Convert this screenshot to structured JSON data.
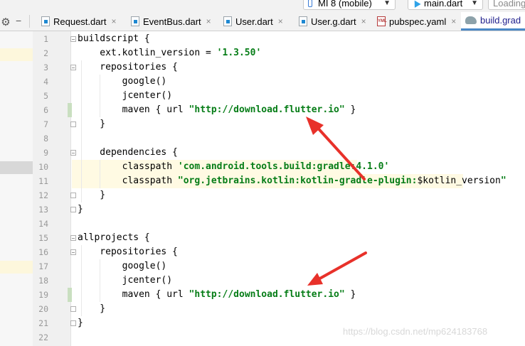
{
  "toolbar": {
    "device": "MI 8 (mobile)",
    "config": "main.dart",
    "loading": "Loading"
  },
  "tabs": [
    {
      "label": "Request.dart",
      "icon": "dart-file-icon",
      "active": false
    },
    {
      "label": "EventBus.dart",
      "icon": "dart-file-icon",
      "active": false
    },
    {
      "label": "User.dart",
      "icon": "dart-file-icon",
      "active": false
    },
    {
      "label": "User.g.dart",
      "icon": "dart-file-icon",
      "active": false
    },
    {
      "label": "pubspec.yaml",
      "icon": "yaml-file-icon",
      "active": false
    },
    {
      "label": "build.grad",
      "icon": "gradle-file-icon",
      "active": true
    }
  ],
  "editor": {
    "line_numbers": [
      "1",
      "2",
      "3",
      "4",
      "5",
      "6",
      "7",
      "8",
      "9",
      "10",
      "11",
      "12",
      "13",
      "14",
      "15",
      "16",
      "17",
      "18",
      "19",
      "20",
      "21",
      "22"
    ],
    "lines": [
      [
        {
          "t": "buildscript {"
        }
      ],
      [
        {
          "t": "    ext.kotlin_version = "
        },
        {
          "t": "'1.3.50'",
          "s": 1
        }
      ],
      [
        {
          "t": "    repositories {"
        }
      ],
      [
        {
          "t": "        google()"
        }
      ],
      [
        {
          "t": "        jcenter()"
        }
      ],
      [
        {
          "t": "        maven { url "
        },
        {
          "t": "\"http://download.flutter.io\"",
          "s": 1
        },
        {
          "t": " }"
        }
      ],
      [
        {
          "t": "    }"
        }
      ],
      [
        {
          "t": ""
        }
      ],
      [
        {
          "t": "    dependencies {"
        }
      ],
      [
        {
          "t": "        classpath "
        },
        {
          "t": "'com.android.tools.build:gradle:4.1.0'",
          "s": 1
        }
      ],
      [
        {
          "t": "        classpath "
        },
        {
          "t": "\"org.jetbrains.kotlin:kotlin-gradle-plugin:",
          "s": 1
        },
        {
          "t": "$kotlin_version"
        },
        {
          "t": "\"",
          "s": 1
        }
      ],
      [
        {
          "t": "    }"
        }
      ],
      [
        {
          "t": "}"
        }
      ],
      [
        {
          "t": ""
        }
      ],
      [
        {
          "t": "allprojects {"
        }
      ],
      [
        {
          "t": "    repositories {"
        }
      ],
      [
        {
          "t": "        google()"
        }
      ],
      [
        {
          "t": "        jcenter()"
        }
      ],
      [
        {
          "t": "        maven { url "
        },
        {
          "t": "\"http://download.flutter.io\"",
          "s": 1
        },
        {
          "t": " }"
        }
      ],
      [
        {
          "t": "    }"
        }
      ],
      [
        {
          "t": "}"
        }
      ],
      [
        {
          "t": ""
        }
      ]
    ]
  },
  "colors": {
    "string": "#067d17",
    "arrow": "#e8312a",
    "active_tab_underline": "#4a88c7",
    "caret_line": "#fffae3"
  },
  "watermark": "https://blog.csdn.net/mp624183768"
}
